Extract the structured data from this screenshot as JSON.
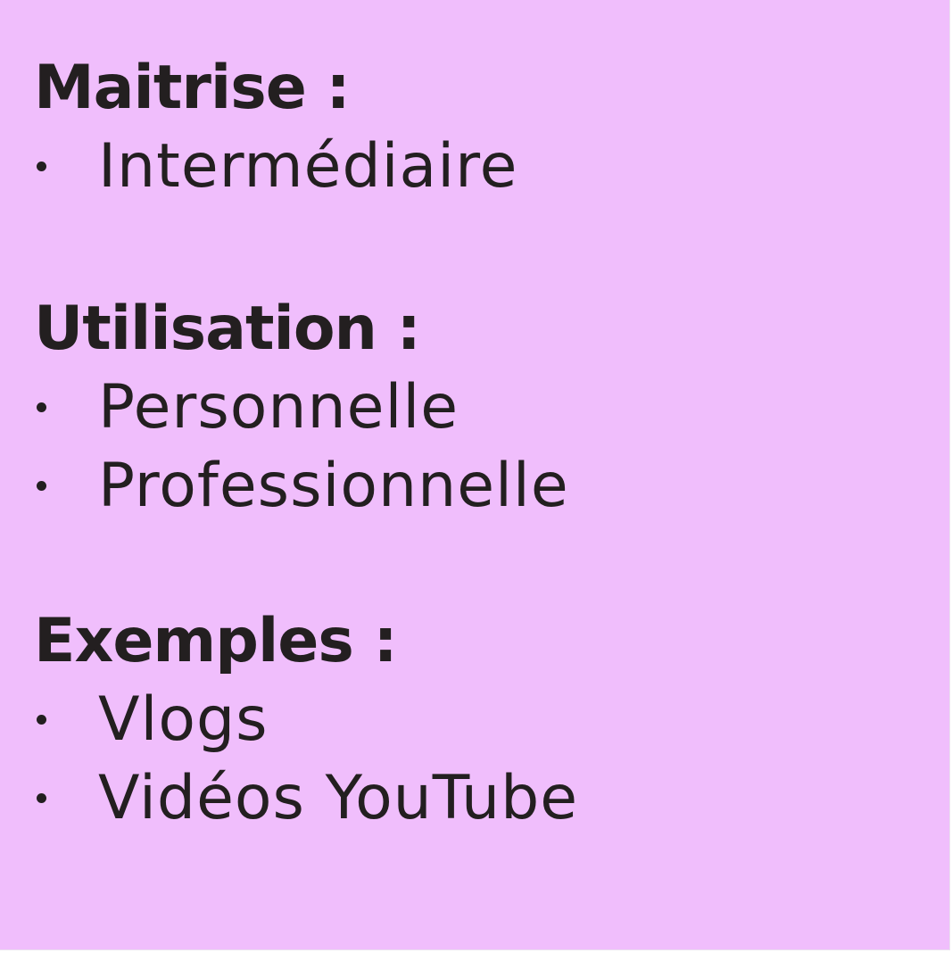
{
  "colors": {
    "background": "#f0befc",
    "text": "#231f20"
  },
  "sections": [
    {
      "heading": "Maitrise :",
      "items": [
        "Intermédiaire"
      ]
    },
    {
      "heading": "Utilisation :",
      "items": [
        "Personnelle",
        "Professionnelle"
      ]
    },
    {
      "heading": "Exemples :",
      "items": [
        "Vlogs",
        "Vidéos YouTube"
      ]
    }
  ]
}
